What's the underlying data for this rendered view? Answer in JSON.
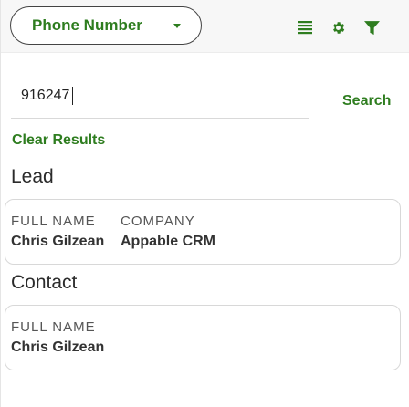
{
  "header": {
    "field_selector": {
      "selected": "Phone Number"
    },
    "icons": [
      "list-icon",
      "gear-icon",
      "filter-icon"
    ]
  },
  "search": {
    "value": "916247",
    "button_label": "Search"
  },
  "clear_label": "Clear Results",
  "sections": {
    "lead": {
      "title": "Lead",
      "fields": [
        {
          "key": "FULL NAME",
          "value": "Chris Gilzean"
        },
        {
          "key": "COMPANY",
          "value": "Appable CRM"
        }
      ]
    },
    "contact": {
      "title": "Contact",
      "fields": [
        {
          "key": "FULL NAME",
          "value": "Chris Gilzean"
        }
      ]
    }
  },
  "colors": {
    "accent": "#2e7d1f",
    "header_bg": "#f7f7f7",
    "card_border": "#d8d8d8"
  }
}
